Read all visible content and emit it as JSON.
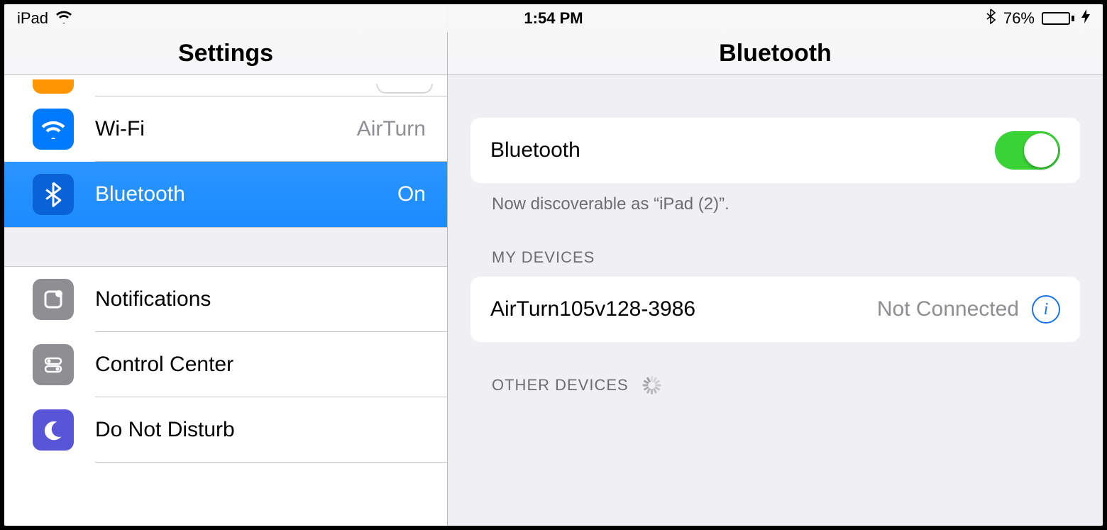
{
  "status": {
    "device": "iPad",
    "time": "1:54 PM",
    "battery_pct": "76%"
  },
  "sidebar": {
    "title": "Settings",
    "items": [
      {
        "label": "Wi-Fi",
        "value": "AirTurn",
        "icon": "wifi",
        "color": "#007aff"
      },
      {
        "label": "Bluetooth",
        "value": "On",
        "icon": "bluetooth",
        "color": "#007aff"
      },
      {
        "label": "Notifications",
        "value": "",
        "icon": "notification",
        "color": "#8e8e93"
      },
      {
        "label": "Control Center",
        "value": "",
        "icon": "control-center",
        "color": "#8e8e93"
      },
      {
        "label": "Do Not Disturb",
        "value": "",
        "icon": "moon",
        "color": "#5856d6"
      }
    ]
  },
  "detail": {
    "title": "Bluetooth",
    "toggle_label": "Bluetooth",
    "toggle_on": true,
    "discoverable_note": "Now discoverable as “iPad (2)”.",
    "my_devices_header": "MY DEVICES",
    "my_devices": [
      {
        "name": "AirTurn105v128-3986",
        "status": "Not Connected"
      }
    ],
    "other_devices_header": "OTHER DEVICES"
  }
}
